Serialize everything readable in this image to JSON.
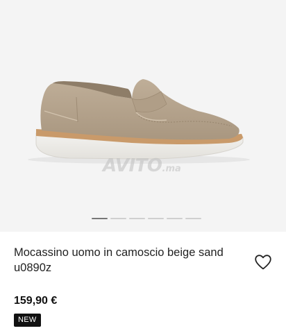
{
  "gallery": {
    "image_alt": "Beige suede loafer",
    "watermark": "AVITO",
    "watermark_suffix": ".ma",
    "slide_count": 6,
    "active_slide": 1
  },
  "product": {
    "title": "Mocassino uomo in camoscio beige sand u0890z",
    "price": "159,90 €",
    "badge": "NEW"
  },
  "icons": {
    "favorite": "heart-outline-icon"
  },
  "colors": {
    "suede": "#b7a690",
    "sole": "#efeeeb",
    "welt": "#c99a6a",
    "badge_bg": "#111111"
  }
}
